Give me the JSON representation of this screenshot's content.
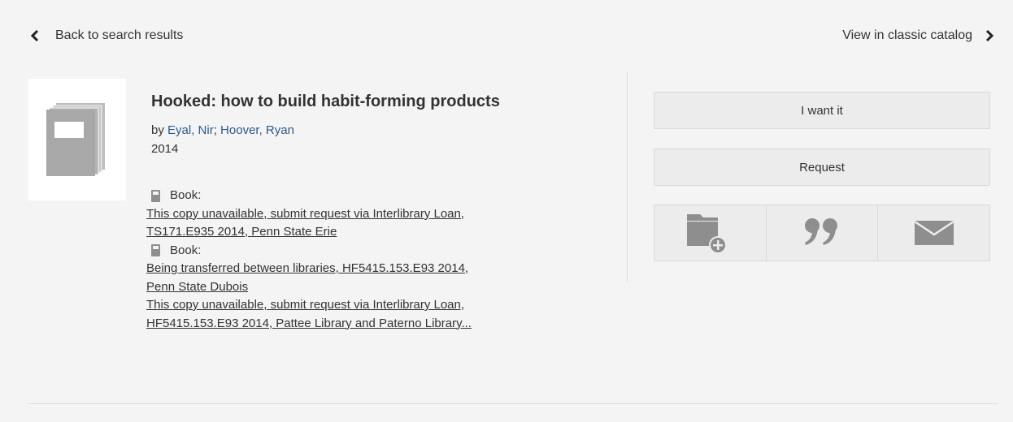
{
  "nav": {
    "back_label": "Back to search results",
    "classic_label": "View in classic catalog"
  },
  "record": {
    "title_bold": "Hooked:",
    "title_rest": " how to build habit-forming products",
    "by_label": "by ",
    "authors": [
      "Eyal, Nir",
      "Hoover, Ryan"
    ],
    "author_sep": "; ",
    "year": "2014"
  },
  "holdings": [
    {
      "format": "Book:",
      "items": [
        [
          "This copy unavailable, submit request via Interlibrary Loan,",
          "TS171.E935 2014, Penn State Erie"
        ]
      ]
    },
    {
      "format": "Book:",
      "items": [
        [
          "Being transferred between libraries, HF5415.153.E93 2014,",
          "Penn State Dubois"
        ],
        [
          "This copy unavailable, submit request via Interlibrary Loan,",
          "HF5415.153.E93 2014, Pattee Library and Paterno Library..."
        ]
      ]
    }
  ],
  "actions": {
    "want_label": "I want it",
    "request_label": "Request",
    "icons": [
      "add-to-folder-icon",
      "cite-quote-icon",
      "email-icon"
    ]
  },
  "colors": {
    "background": "#f4f4f4",
    "button": "#ececec",
    "link": "#2c5a8a",
    "icon": "#8e8e8e"
  }
}
